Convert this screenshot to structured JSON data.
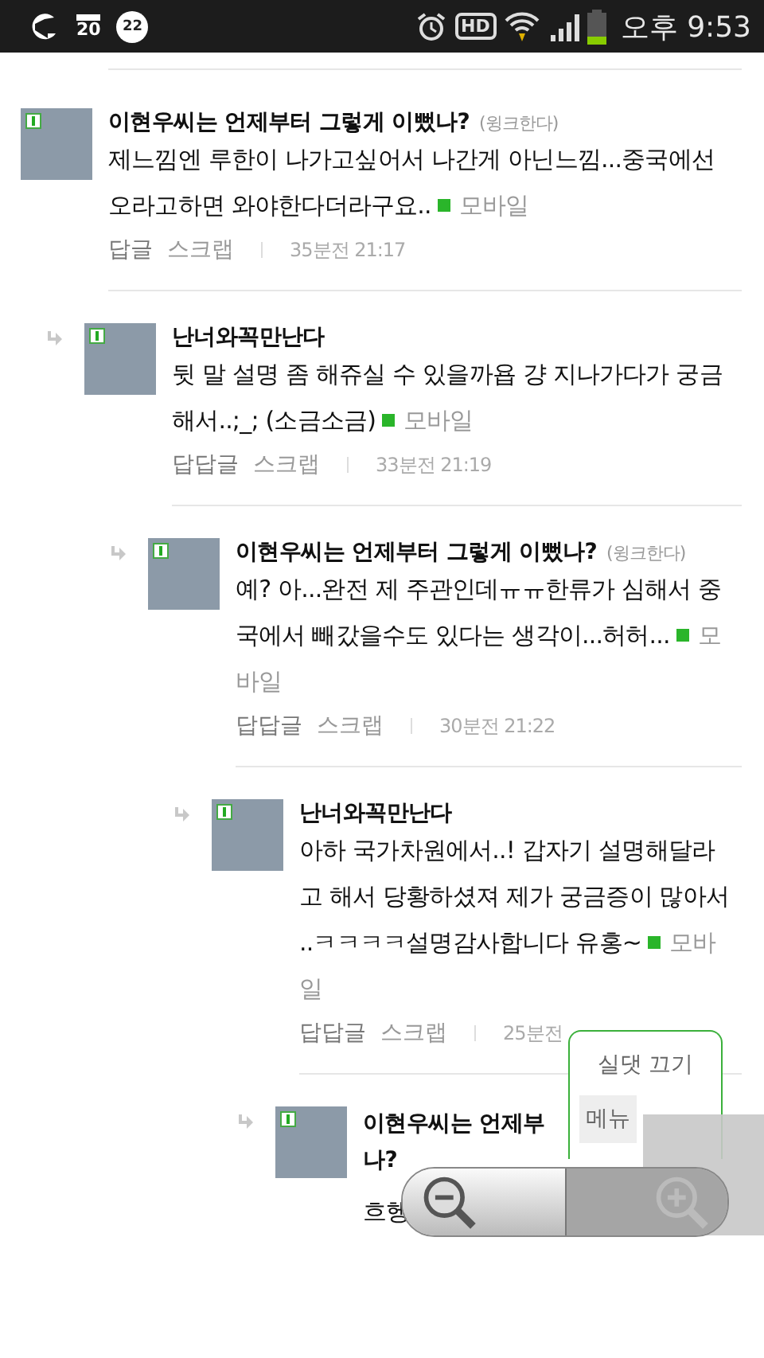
{
  "status_bar": {
    "notifications": [
      "20",
      "22"
    ],
    "network": "HD",
    "time": "오후 9:53"
  },
  "comments": [
    {
      "kind": "full",
      "name": "이현우씨는 언제부터 그렇게 이뻤나?",
      "nick": "(윙크한다)",
      "body": "제느낌엔 루한이 나가고싶어서 나간게 아닌느낌...중국에선 오라고하면 와야한다더라구요..",
      "tag": "모바일",
      "actions": [
        "답글",
        "스크랩"
      ],
      "time": "35분전 21:17",
      "children": [
        {
          "kind": "full",
          "name": "난너와꼭만난다",
          "body": "뒷 말 설명 좀 해쥬실 수 있을까욥 걍 지나가다가 궁금해서..;_; (소금소금)",
          "tag": "모바일",
          "actions": [
            "답답글",
            "스크랩"
          ],
          "time": "33분전 21:19",
          "children": [
            {
              "kind": "full",
              "name": "이현우씨는 언제부터 그렇게 이뻤나?",
              "nick": "(윙크한다)",
              "body": "예? 아...완전 제 주관인데ㅠㅠ한류가 심해서 중국에서 빼갔을수도 있다는 생각이...허허...",
              "tag": "모바일",
              "actions": [
                "답답글",
                "스크랩"
              ],
              "time": "30분전 21:22",
              "children": [
                {
                  "kind": "full",
                  "name": "난너와꼭만난다",
                  "body": "아하 국가차원에서..! 갑자기 설명해달라고 해서 당황하셨져 제가 궁금증이 많아서 ..ㅋㅋㅋㅋ설명감사합니다 유홍~",
                  "tag": "모바일",
                  "actions": [
                    "답답글",
                    "스크랩"
                  ],
                  "time": "25분전",
                  "children": [
                    {
                      "kind": "partial",
                      "name_lines": [
                        "이현우씨는 언제부",
                        "나?"
                      ],
                      "body": "흐헹"
                    }
                  ]
                }
              ]
            }
          ]
        }
      ]
    }
  ],
  "floating_menu": {
    "items": [
      {
        "label": "실댓 끄기",
        "selected": false
      },
      {
        "label": "메뉴",
        "selected": true
      }
    ]
  },
  "zoom_controls": {
    "zoom_in_disabled": true
  }
}
